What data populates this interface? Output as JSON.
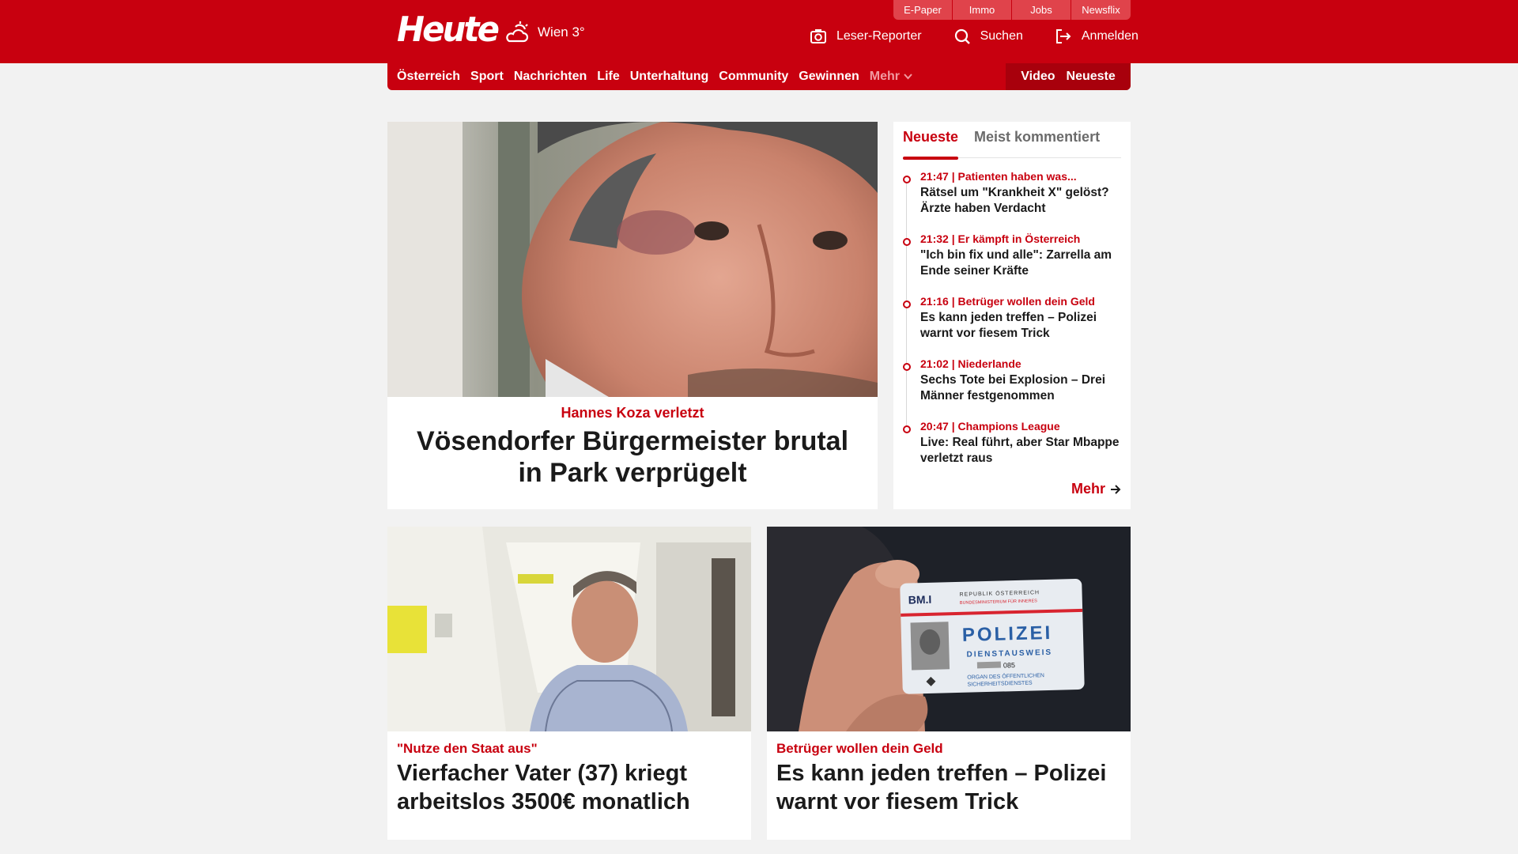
{
  "header": {
    "logo": "Heute",
    "weather": {
      "icon": "cloud-sun-icon",
      "text": "Wien 3°"
    },
    "quicklinks": [
      "E-Paper",
      "Immo",
      "Jobs",
      "Newsflix"
    ],
    "actions": [
      {
        "icon": "camera-icon",
        "label": "Leser-Reporter"
      },
      {
        "icon": "search-icon",
        "label": "Suchen"
      },
      {
        "icon": "login-icon",
        "label": "Anmelden"
      }
    ],
    "brand_color": "#c8000f"
  },
  "nav": {
    "items": [
      "Österreich",
      "Sport",
      "Nachrichten",
      "Life",
      "Unterhaltung",
      "Community",
      "Gewinnen"
    ],
    "more": "Mehr",
    "right": [
      "Video",
      "Neueste"
    ]
  },
  "hero": {
    "image": "portrait-man-bruised-eye",
    "kicker": "Hannes Koza verletzt",
    "title": "Vösendorfer Bürgermeister brutal in Park verprügelt"
  },
  "sidebar": {
    "tabs": [
      "Neueste",
      "Meist kommentiert"
    ],
    "items": [
      {
        "time": "21:47",
        "topic": "Patienten haben was...",
        "title": "Rätsel um \"Krankheit X\" gelöst? Ärzte haben Verdacht"
      },
      {
        "time": "21:32",
        "topic": "Er kämpft in Österreich",
        "title": "\"Ich bin fix und alle\": Zarrella am Ende seiner Kräfte"
      },
      {
        "time": "21:16",
        "topic": "Betrüger wollen dein Geld",
        "title": "Es kann jeden treffen – Polizei warnt vor fiesem Trick"
      },
      {
        "time": "21:02",
        "topic": "Niederlande",
        "title": "Sechs Tote bei Explosion – Drei Männer festgenommen"
      },
      {
        "time": "20:47",
        "topic": "Champions League",
        "title": "Live: Real führt, aber Star Mbappe verletzt raus"
      }
    ],
    "more": "Mehr"
  },
  "cards": [
    {
      "image": "man-in-hallway",
      "kicker": "\"Nutze den Staat aus\"",
      "title": "Vierfacher Vater (37) kriegt arbeitslos 3500€ monatlich"
    },
    {
      "image": "police-id-card",
      "kicker": "Betrüger wollen dein Geld",
      "title": "Es kann jeden treffen – Polizei warnt vor fiesem Trick",
      "image_text": {
        "issuer": "BM.I",
        "republic": "REPUBLIK ÖSTERREICH",
        "ministry": "BUNDESMINISTERIUM FÜR INNERES",
        "word": "POLIZEI",
        "sub": "DIENSTAUSWEIS",
        "number": "085",
        "footer1": "ORGAN DES ÖFFENTLICHEN",
        "footer2": "SICHERHEITSDIENSTES"
      }
    }
  ]
}
